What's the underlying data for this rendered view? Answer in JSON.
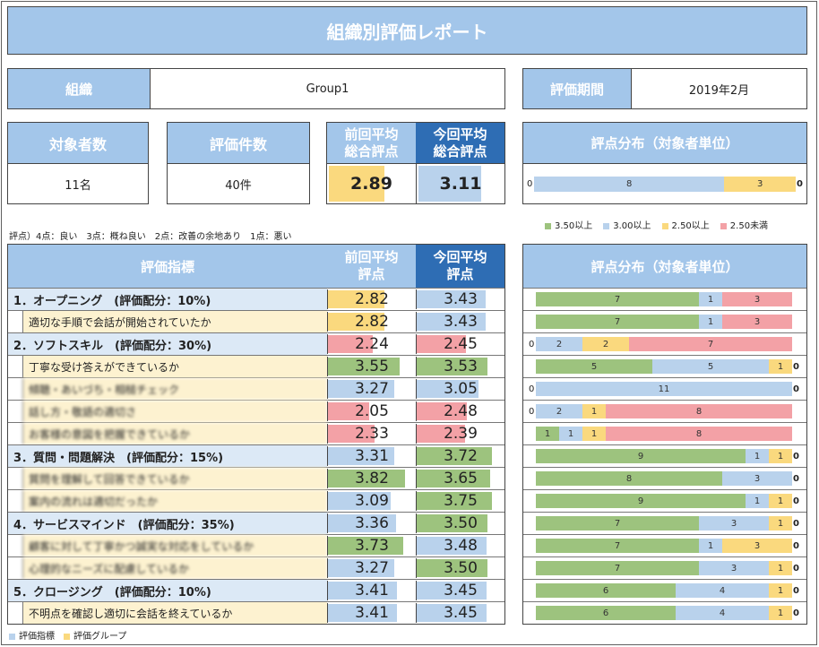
{
  "title": "組織別評価レポート",
  "org_label": "組織",
  "org_value": "Group1",
  "period_label": "評価期間",
  "period_value": "2019年2月",
  "target_label": "対象者数",
  "target_value": "11名",
  "count_label": "評価件数",
  "count_value": "40件",
  "prev_label": "前回平均\n総合評点",
  "prev_value": "2.89",
  "curr_label": "今回平均\n総合評点",
  "curr_value": "3.11",
  "dist_label": "評点分布（対象者単位）",
  "dist_label2": "評点分布（対象者単位）",
  "scale_note": "評点）4点：良い　3点：概ね良い　2点：改善の余地あり　1点：悪い",
  "legend": [
    {
      "label": "3.50以上",
      "color": "#9dc37e"
    },
    {
      "label": "3.00以上",
      "color": "#b9d2ec"
    },
    {
      "label": "2.50以上",
      "color": "#fad97e"
    },
    {
      "label": "2.50未満",
      "color": "#f3a1a6"
    }
  ],
  "summary_dist": {
    "segments": [
      0,
      8,
      3,
      0
    ],
    "labels": [
      "0",
      "8",
      "3",
      "0"
    ]
  },
  "metric_header": "評価指標",
  "prev_col": "前回平均\n評点",
  "curr_col": "今回平均\n評点",
  "rows": [
    {
      "label": "1．オープニング　(評価配分：10%)",
      "group": true,
      "prev": "2.82",
      "curr": "3.43",
      "blur": false,
      "dist": [
        7,
        1,
        0,
        3
      ],
      "dl": [
        "7",
        "1",
        "0",
        "3"
      ]
    },
    {
      "label": "適切な手順で会話が開始されていたか",
      "group": false,
      "prev": "2.82",
      "curr": "3.43",
      "blur": false,
      "dist": [
        7,
        1,
        0,
        3
      ],
      "dl": [
        "7",
        "1",
        "0",
        "3"
      ]
    },
    {
      "label": "2．ソフトスキル　(評価配分：30%)",
      "group": true,
      "prev": "2.24",
      "curr": "2.45",
      "blur": false,
      "dist": [
        0,
        2,
        2,
        7
      ],
      "dl": [
        "0",
        "2",
        "2",
        "7"
      ]
    },
    {
      "label": "丁寧な受け答えができているか",
      "group": false,
      "prev": "3.55",
      "curr": "3.53",
      "blur": false,
      "dist": [
        5,
        5,
        1,
        0
      ],
      "dl": [
        "5",
        "5",
        "1",
        "0"
      ]
    },
    {
      "label": "傾聴・あいづち・相槌チェック",
      "group": false,
      "prev": "3.27",
      "curr": "3.05",
      "blur": true,
      "dist": [
        0,
        11,
        0,
        0
      ],
      "dl": [
        "0",
        "11",
        "",
        "0"
      ]
    },
    {
      "label": "話し方・敬語の適切さ",
      "group": false,
      "prev": "2.05",
      "curr": "2.48",
      "blur": true,
      "dist": [
        0,
        2,
        1,
        8
      ],
      "dl": [
        "0",
        "2",
        "1",
        "8"
      ]
    },
    {
      "label": "お客様の意図を把握できているか",
      "group": false,
      "prev": "2.33",
      "curr": "2.39",
      "blur": true,
      "dist": [
        1,
        1,
        1,
        8
      ],
      "dl": [
        "1",
        "1",
        "1",
        "8"
      ]
    },
    {
      "label": "3．質問・問題解決　(評価配分：15%)",
      "group": true,
      "prev": "3.31",
      "curr": "3.72",
      "blur": false,
      "dist": [
        9,
        1,
        1,
        0
      ],
      "dl": [
        "9",
        "1",
        "1",
        "0"
      ]
    },
    {
      "label": "質問を理解して回答できているか",
      "group": false,
      "prev": "3.82",
      "curr": "3.65",
      "blur": true,
      "dist": [
        8,
        3,
        0,
        0
      ],
      "dl": [
        "8",
        "3",
        "",
        "0"
      ]
    },
    {
      "label": "案内の流れは適切だったか",
      "group": false,
      "prev": "3.09",
      "curr": "3.75",
      "blur": true,
      "dist": [
        9,
        1,
        1,
        0
      ],
      "dl": [
        "9",
        "1",
        "1",
        "0"
      ]
    },
    {
      "label": "4．サービスマインド　(評価配分：35%)",
      "group": true,
      "prev": "3.36",
      "curr": "3.50",
      "blur": false,
      "dist": [
        7,
        3,
        1,
        0
      ],
      "dl": [
        "7",
        "3",
        "1",
        "0"
      ]
    },
    {
      "label": "顧客に対して丁寧かつ誠実な対応をしているか",
      "group": false,
      "prev": "3.73",
      "curr": "3.48",
      "blur": true,
      "dist": [
        7,
        1,
        3,
        0
      ],
      "dl": [
        "7",
        "1",
        "3",
        "0"
      ]
    },
    {
      "label": "心理的なニーズに配慮しているか",
      "group": false,
      "prev": "3.27",
      "curr": "3.50",
      "blur": true,
      "dist": [
        7,
        3,
        1,
        0
      ],
      "dl": [
        "7",
        "3",
        "1",
        "0"
      ]
    },
    {
      "label": "5．クロージング　(評価配分：10%)",
      "group": true,
      "prev": "3.41",
      "curr": "3.45",
      "blur": false,
      "dist": [
        6,
        4,
        1,
        0
      ],
      "dl": [
        "6",
        "4",
        "1",
        "0"
      ]
    },
    {
      "label": "不明点を確認し適切に会話を終えているか",
      "group": false,
      "prev": "3.41",
      "curr": "3.45",
      "blur": false,
      "dist": [
        6,
        4,
        1,
        0
      ],
      "dl": [
        "6",
        "4",
        "1",
        "0"
      ]
    }
  ],
  "footer_legend": [
    {
      "label": "評価指標",
      "color": "#b9d2ec"
    },
    {
      "label": "評価グループ",
      "color": "#fad97e"
    }
  ]
}
